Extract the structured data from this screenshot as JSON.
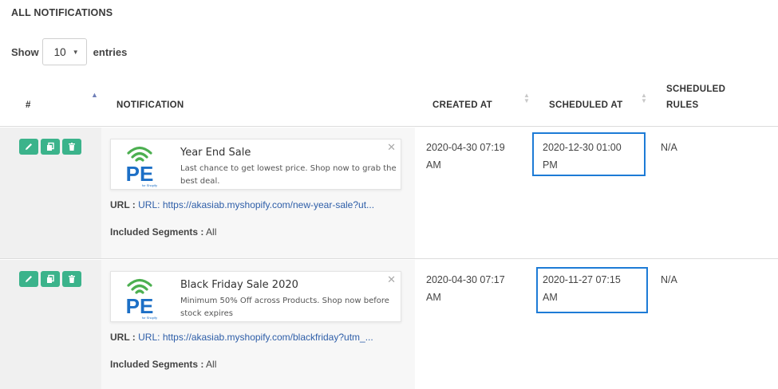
{
  "title": "ALL NOTIFICATIONS",
  "length_menu": {
    "show_label": "Show",
    "value": "10",
    "entries_label": "entries"
  },
  "columns": {
    "index": "#",
    "notification": "NOTIFICATION",
    "created_at": "CREATED AT",
    "scheduled_at": "SCHEDULED AT",
    "scheduled_rules_1": "SCHEDULED",
    "scheduled_rules_2": "RULES"
  },
  "rows": [
    {
      "title": "Year End Sale",
      "body": "Last chance to get lowest price. Shop now to grab the best deal.",
      "url_label": "URL :",
      "url_prefix": "URL:",
      "url": "https://akasiab.myshopify.com/new-year-sale?ut...",
      "segments_label": "Included Segments :",
      "segments": "All",
      "created_date": "2020-04-30 07:19",
      "created_ampm": "AM",
      "scheduled_date": "2020-12-30 01:00",
      "scheduled_ampm": "PM",
      "rules": "N/A"
    },
    {
      "title": "Black Friday Sale 2020",
      "body": "Minimum 50% Off across Products. Shop now before stock expires",
      "url_label": "URL :",
      "url_prefix": "URL:",
      "url": "https://akasiab.myshopify.com/blackfriday?utm_...",
      "segments_label": "Included Segments :",
      "segments": "All",
      "created_date": "2020-04-30 07:17",
      "created_ampm": "AM",
      "scheduled_date": "2020-11-27 07:15",
      "scheduled_ampm": "AM",
      "rules": "N/A"
    }
  ],
  "logo": {
    "text": "PE",
    "sub": "for Shopify"
  },
  "colors": {
    "action_green": "#3bb38b",
    "highlight_blue": "#1d7bd6",
    "link_blue": "#2e5ea8",
    "logo_green": "#4caf50",
    "logo_blue": "#1c6fc6"
  },
  "icons": [
    "edit-icon",
    "duplicate-icon",
    "trash-icon",
    "close-icon",
    "sort-icon"
  ]
}
